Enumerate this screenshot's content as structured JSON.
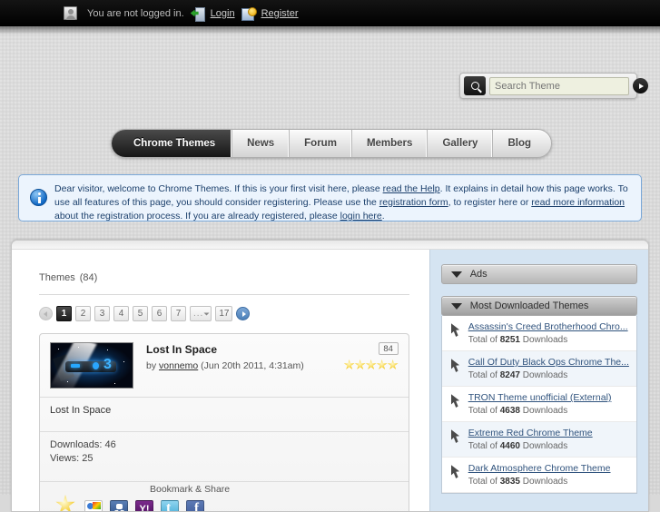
{
  "topbar": {
    "status": "You are not logged in.",
    "login_label": "Login",
    "register_label": "Register"
  },
  "search": {
    "placeholder": "Search Theme",
    "value": ""
  },
  "nav": {
    "items": [
      {
        "label": "Chrome Themes",
        "active": true
      },
      {
        "label": "News",
        "active": false
      },
      {
        "label": "Forum",
        "active": false
      },
      {
        "label": "Members",
        "active": false
      },
      {
        "label": "Gallery",
        "active": false
      },
      {
        "label": "Blog",
        "active": false
      }
    ]
  },
  "notice": {
    "part1": "Dear visitor, welcome to Chrome Themes. If this is your first visit here, please ",
    "link1": "read the Help",
    "part2": ". It explains in detail how this page works. To use all features of this page, you should consider registering. Please use the ",
    "link2": "registration form",
    "part3": ", to register here or ",
    "link3": "read more information",
    "part4": " about the registration process. If you are already registered, please ",
    "link4": "login here",
    "part5": "."
  },
  "main": {
    "title": "Themes",
    "count": "(84)",
    "pagination": {
      "pages": [
        "1",
        "2",
        "3",
        "4",
        "5",
        "6",
        "7",
        "...",
        "17"
      ],
      "active": "1"
    },
    "theme": {
      "title": "Lost In Space",
      "by_prefix": "by ",
      "author": "vonnemo",
      "date": " (Jun 20th 2011, 4:31am)",
      "badge": "84",
      "stars": 5,
      "description": "Lost In Space",
      "downloads_label": "Downloads: 46",
      "views_label": "Views: 25",
      "share_label": "Bookmark & Share",
      "share_icons": [
        "google-bookmarks-icon",
        "mister-wong-icon",
        "yahoo-icon",
        "twitter-icon",
        "facebook-icon"
      ]
    }
  },
  "sidebar": {
    "panels": [
      {
        "title": "Ads",
        "items": []
      },
      {
        "title": "Most Downloaded Themes",
        "items": [
          {
            "name": "Assassin's Creed Brotherhood Chro...",
            "downloads_prefix": "Total of ",
            "downloads": "8251",
            "downloads_suffix": " Downloads"
          },
          {
            "name": "Call Of Duty Black Ops Chrome The...",
            "downloads_prefix": "Total of ",
            "downloads": "8247",
            "downloads_suffix": " Downloads"
          },
          {
            "name": "TRON Theme unofficial (External)",
            "downloads_prefix": "Total of ",
            "downloads": "4638",
            "downloads_suffix": " Downloads"
          },
          {
            "name": "Extreme Red Chrome Theme",
            "downloads_prefix": "Total of ",
            "downloads": "4460",
            "downloads_suffix": " Downloads"
          },
          {
            "name": "Dark Atmosphere Chrome Theme",
            "downloads_prefix": "Total of ",
            "downloads": "3835",
            "downloads_suffix": " Downloads"
          }
        ]
      }
    ]
  },
  "colors": {
    "accent_blue": "#4b7fb8",
    "sidebar_bg": "#d5e4f2",
    "notice_bg": "#ecf4fd",
    "notice_border": "#7aa8d8"
  }
}
